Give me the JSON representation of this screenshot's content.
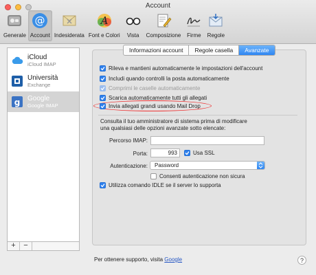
{
  "window": {
    "title": "Account"
  },
  "toolbar": {
    "items": [
      {
        "label": "Generale",
        "icon": "switch-icon"
      },
      {
        "label": "Account",
        "icon": "at-sign-icon",
        "active": true
      },
      {
        "label": "Indesiderata",
        "icon": "junk-mail-icon"
      },
      {
        "label": "Font e Colori",
        "icon": "fonts-colors-icon"
      },
      {
        "label": "Vista",
        "icon": "glasses-icon"
      },
      {
        "label": "Composizione",
        "icon": "compose-icon"
      },
      {
        "label": "Firme",
        "icon": "signature-icon"
      },
      {
        "label": "Regole",
        "icon": "rules-icon"
      }
    ]
  },
  "sidebar": {
    "accounts": [
      {
        "name": "iCloud",
        "type": "iCloud IMAP",
        "icon": "icloud-icon"
      },
      {
        "name": "Università",
        "type": "Exchange",
        "icon": "exchange-icon"
      },
      {
        "name": "Google",
        "type": "Google IMAP",
        "icon": "google-icon",
        "selected": true
      }
    ],
    "add_label": "+",
    "remove_label": "−"
  },
  "tabs": [
    {
      "label": "Informazioni account"
    },
    {
      "label": "Regole casella"
    },
    {
      "label": "Avanzate",
      "active": true
    }
  ],
  "options": [
    {
      "label": "Rileva e mantieni automaticamente le impostazioni dell'account",
      "checked": true
    },
    {
      "label": "Includi quando controlli la posta automaticamente",
      "checked": true
    },
    {
      "label": "Comprimi le caselle automaticamente",
      "checked": true,
      "disabled": true
    },
    {
      "label": "Scarica automaticamente tutti gli allegati",
      "checked": true
    },
    {
      "label": "Invia allegati grandi usando Mail Drop",
      "checked": true,
      "highlighted": true
    }
  ],
  "advanced": {
    "note_line1": "Consulta il tuo amministratore di sistema prima di modificare",
    "note_line2": "una qualsiasi delle opzioni avanzate sotto elencate:",
    "imap_path_label": "Percorso IMAP:",
    "imap_path_value": "",
    "port_label": "Porta:",
    "port_value": "993",
    "ssl_label": "Usa SSL",
    "ssl_checked": true,
    "auth_label": "Autenticazione:",
    "auth_value": "Password",
    "insecure_auth_label": "Consenti autenticazione non sicura",
    "insecure_auth_checked": false,
    "idle_label": "Utilizza comando IDLE se il server lo supporta",
    "idle_checked": true
  },
  "footer": {
    "support_text": "Per ottenere supporto, visita",
    "support_link": "Google",
    "help_label": "?"
  },
  "colors": {
    "accent": "#2f80ed",
    "highlight_oval": "#e33333",
    "link": "#2455c3"
  }
}
